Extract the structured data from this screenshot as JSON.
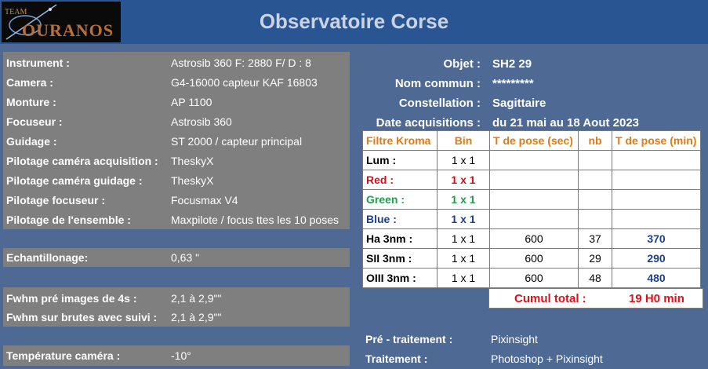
{
  "header": {
    "logo_team": "TEAM",
    "logo_name": "OURANOS",
    "title": "Observatoire Corse"
  },
  "equipment": [
    {
      "label": "Instrument :",
      "value": "Astrosib 360   F: 2880     F/ D : 8"
    },
    {
      "label": "Camera :",
      "value": "G4-16000    capteur KAF 16803"
    },
    {
      "label": "Monture :",
      "value": "AP 1100"
    },
    {
      "label": "Focuseur :",
      "value": "Astrosib 360"
    },
    {
      "label": "Guidage :",
      "value": "ST 2000 / capteur principal"
    },
    {
      "label": "Pilotage caméra acquisition :",
      "value": "TheskyX"
    },
    {
      "label": "Pilotage caméra guidage :",
      "value": "TheskyX"
    },
    {
      "label": "Pilotage focuseur :",
      "value": "Focusmax V4"
    },
    {
      "label": "Pilotage de l'ensemble :",
      "value": "Maxpilote / focus ttes les 10 poses"
    }
  ],
  "sampling": {
    "label": "Echantillonage:",
    "value": "0,63 \""
  },
  "fwhm": [
    {
      "label": "Fwhm pré images de 4s :",
      "value": "2,1 à 2,9\"\""
    },
    {
      "label": "Fwhm sur brutes avec suivi :",
      "value": "2,1 à 2,9\"\""
    }
  ],
  "temperature": {
    "label": "Température caméra :",
    "value": "-10°"
  },
  "object": [
    {
      "label": "Objet :",
      "value": "SH2 29"
    },
    {
      "label": "Nom commun :",
      "value": "*********"
    },
    {
      "label": "Constellation :",
      "value": "Sagittaire"
    },
    {
      "label": "Date acquisitions :",
      "value": "du 21 mai au 18 Aout 2023"
    }
  ],
  "table": {
    "headers": [
      "Filtre Kroma",
      "Bin",
      "T de pose (sec)",
      "nb",
      "T de pose (min)"
    ],
    "rows": [
      {
        "filter": "Lum :",
        "bin": "1 x 1",
        "pose_sec": "",
        "nb": "",
        "pose_min": "",
        "color": "#000000"
      },
      {
        "filter": "Red :",
        "bin": "1 x 1",
        "pose_sec": "",
        "nb": "",
        "pose_min": "",
        "color": "#d0101a"
      },
      {
        "filter": "Green :",
        "bin": "1 x 1",
        "pose_sec": "",
        "nb": "",
        "pose_min": "",
        "color": "#1f9e4a"
      },
      {
        "filter": "Blue :",
        "bin": "1 x 1",
        "pose_sec": "",
        "nb": "",
        "pose_min": "",
        "color": "#1f3f8a"
      },
      {
        "filter": "Ha 3nm :",
        "bin": "1 x 1",
        "pose_sec": "600",
        "nb": "37",
        "pose_min": "370",
        "color": "#000000"
      },
      {
        "filter": "SII 3nm :",
        "bin": "1 x 1",
        "pose_sec": "600",
        "nb": "29",
        "pose_min": "290",
        "color": "#000000"
      },
      {
        "filter": "OIII  3nm :",
        "bin": "1 x 1",
        "pose_sec": "600",
        "nb": "48",
        "pose_min": "480",
        "color": "#000000"
      }
    ],
    "cumul_label": "Cumul total :",
    "cumul_value": "19 H0 min"
  },
  "processing": [
    {
      "label": "Pré - traitement :",
      "value": "Pixinsight"
    },
    {
      "label": "Traitement :",
      "value": "Photoshop + Pixinsight"
    }
  ],
  "colors": {
    "background": "#4e6a94",
    "header": "#2a5593",
    "panel": "#7f7f7f",
    "table_header": "#e07a12",
    "total_blue": "#1f3f8a",
    "cumul_red": "#e0101a"
  }
}
